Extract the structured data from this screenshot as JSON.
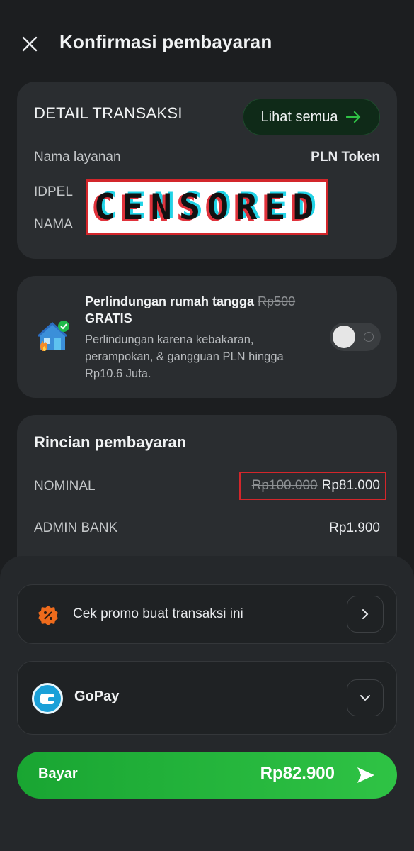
{
  "header": {
    "title": "Konfirmasi pembayaran"
  },
  "detail": {
    "title": "DETAIL TRANSAKSI",
    "see_all_label": "Lihat semua",
    "service_label": "Nama layanan",
    "service_value": "PLN Token",
    "idpel_label": "IDPEL",
    "nama_label": "NAMA",
    "censor_text": "CENSORED"
  },
  "protection": {
    "title": "Perlindungan rumah tangga",
    "old_price": "Rp500",
    "free_label": "GRATIS",
    "description": "Perlindungan karena kebakaran, perampokan, & gangguan PLN hingga Rp10.6 Juta.",
    "enabled": false
  },
  "rincian": {
    "title": "Rincian pembayaran",
    "nominal_label": "NOMINAL",
    "nominal_old": "Rp100.000",
    "nominal_new": "Rp81.000",
    "admin_label": "ADMIN BANK",
    "admin_value": "Rp1.900"
  },
  "promo": {
    "label": "Cek promo buat transaksi ini"
  },
  "payment": {
    "method": "GoPay"
  },
  "pay_button": {
    "label": "Bayar",
    "amount": "Rp82.900"
  },
  "colors": {
    "accent": "#2fc345",
    "background": "#1c1e20",
    "card": "#2a2d30",
    "highlight": "#d3262b"
  }
}
